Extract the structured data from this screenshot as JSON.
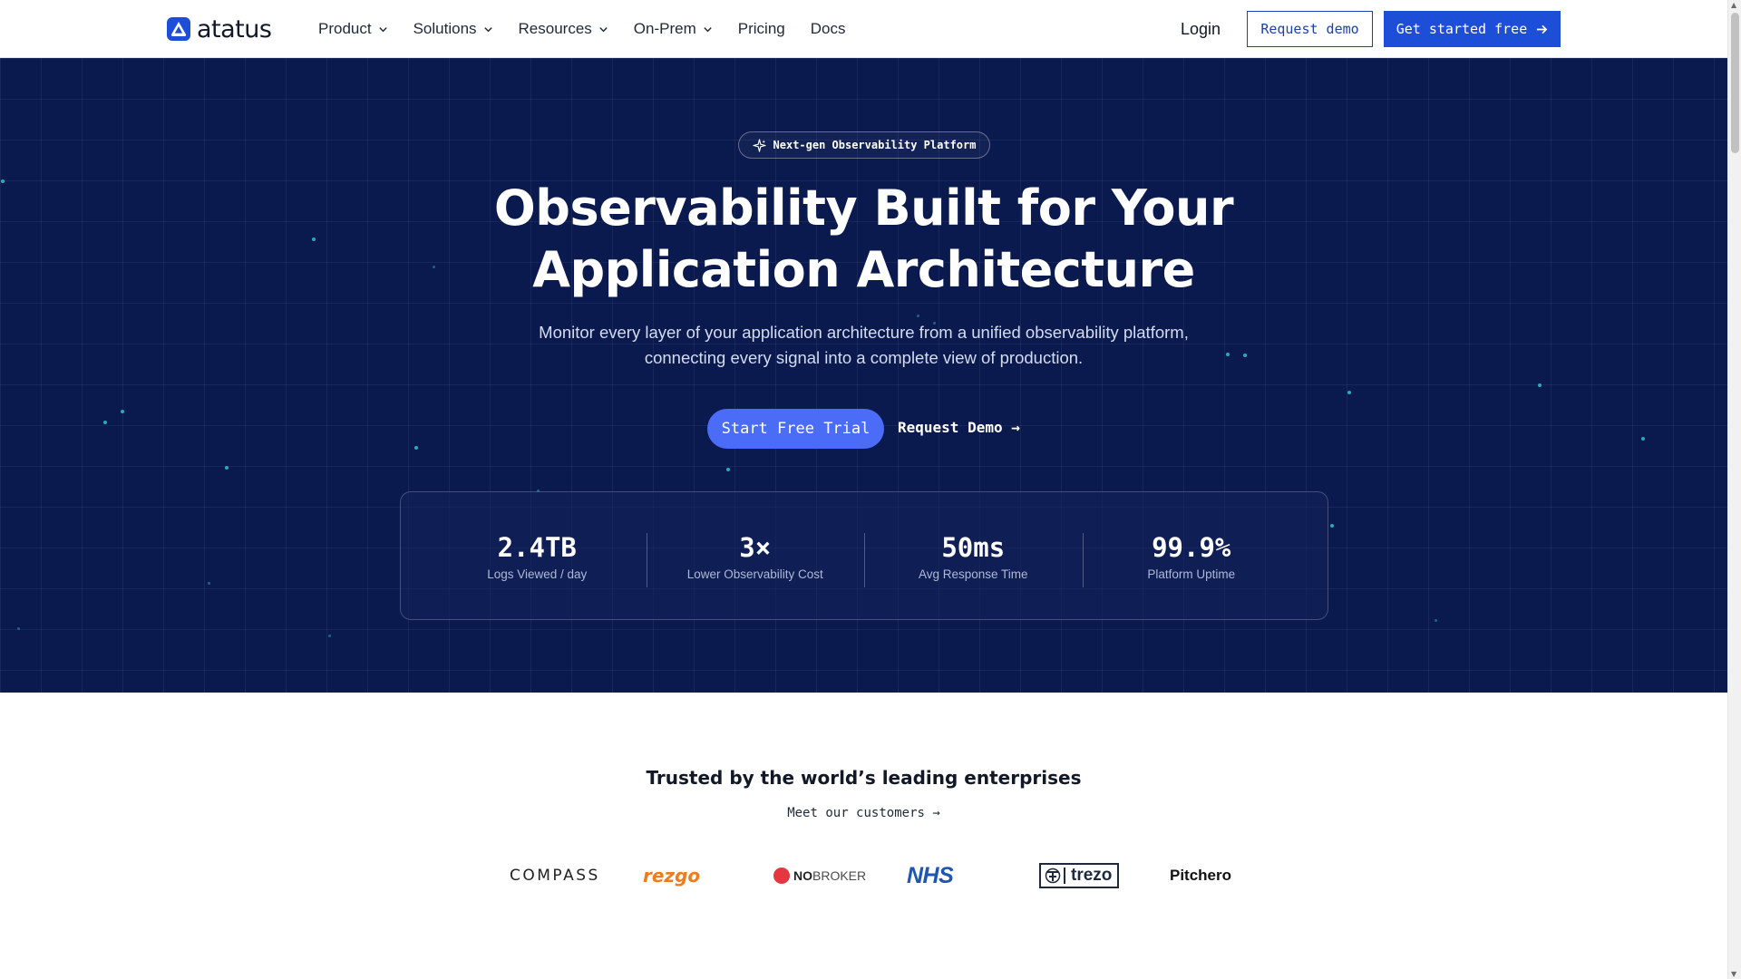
{
  "brand": {
    "name": "atatus",
    "accent": "#1d4ed8",
    "hero_bg": "#0a1a4f"
  },
  "nav": {
    "items": [
      {
        "label": "Product",
        "has_dropdown": true
      },
      {
        "label": "Solutions",
        "has_dropdown": true
      },
      {
        "label": "Resources",
        "has_dropdown": true
      },
      {
        "label": "On-Prem",
        "has_dropdown": true
      },
      {
        "label": "Pricing",
        "has_dropdown": false
      },
      {
        "label": "Docs",
        "has_dropdown": false
      }
    ],
    "login": "Login",
    "request_demo": "Request demo",
    "get_started": "Get started free"
  },
  "hero": {
    "badge": "Next-gen Observability Platform",
    "title_line1": "Observability Built for Your",
    "title_line2": "Application Architecture",
    "subtitle_line1": "Monitor every layer of your application architecture from a unified observability platform,",
    "subtitle_line2": "connecting every signal into a complete view of production.",
    "cta_primary": "Start Free Trial",
    "cta_secondary": "Request Demo →"
  },
  "stats": [
    {
      "value": "2.4TB",
      "label": "Logs Viewed / day"
    },
    {
      "value": "3×",
      "label": "Lower Observability Cost"
    },
    {
      "value": "50ms",
      "label": "Avg Response Time"
    },
    {
      "value": "99.9%",
      "label": "Platform Uptime"
    }
  ],
  "trusted": {
    "title": "Trusted by the world’s leading enterprises",
    "link": "Meet our customers →",
    "logos": {
      "compass": "COMPASS",
      "rezgo": "rezgo",
      "nobroker_bold": "NO",
      "nobroker_rest": "BROKER",
      "nhs": "NHS",
      "trezo": "trezo",
      "pitchero": "Pitchero"
    }
  }
}
